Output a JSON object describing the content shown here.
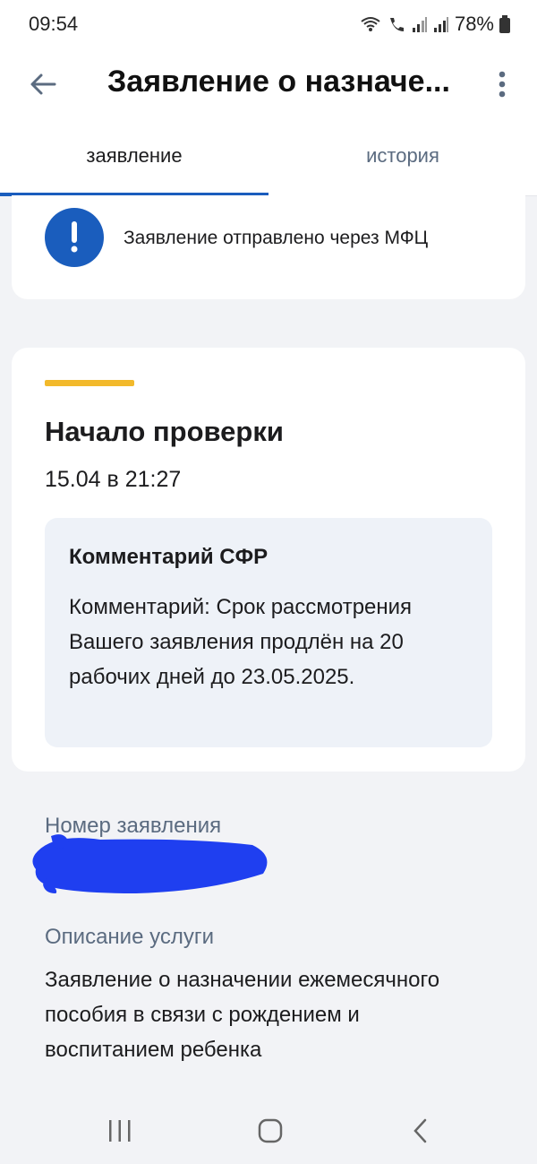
{
  "status_bar": {
    "time": "09:54",
    "battery": "78%",
    "icons": [
      "wifi-icon",
      "wifi-call-icon",
      "signal-icon",
      "signal-icon",
      "battery-icon"
    ]
  },
  "app_bar": {
    "title": "Заявление о назначе...",
    "back_icon": "arrow-left-icon",
    "more_icon": "more-vertical-icon"
  },
  "tabs": [
    {
      "label": "заявление",
      "active": true
    },
    {
      "label": "история",
      "active": false
    }
  ],
  "notice": {
    "icon": "exclamation-icon",
    "text": "Заявление отправлено через МФЦ"
  },
  "status_card": {
    "title": "Начало проверки",
    "date": "15.04 в 21:27",
    "accent_color": "#f2b92b",
    "comment": {
      "title": "Комментарий СФР",
      "text": "Комментарий: Срок рассмотрения Вашего заявления продлён на 20 рабочих дней до 23.05.2025."
    }
  },
  "details": {
    "number_label": "Номер заявления",
    "description_label": "Описание услуги",
    "description_text": "Заявление о назначении ежемесячного пособия в связи с рождением и воспитанием ребенка"
  },
  "colors": {
    "primary": "#1a5dbd",
    "accent": "#f2b92b",
    "label": "#5b6b80",
    "background": "#f2f3f6"
  }
}
